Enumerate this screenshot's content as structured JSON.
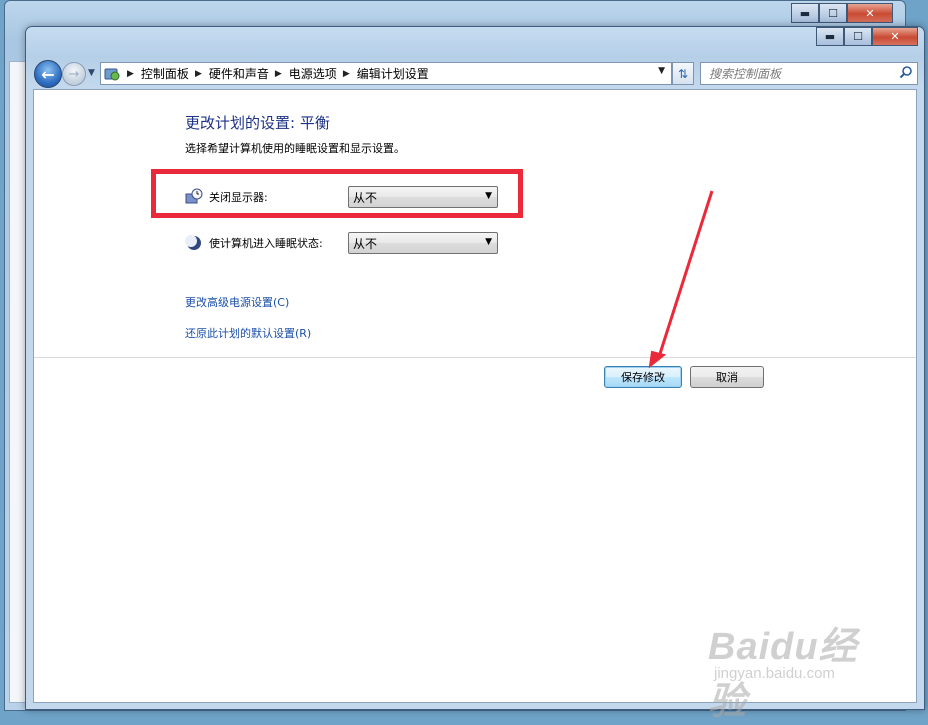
{
  "background_window": {
    "controls": {
      "minimize": "▬",
      "maximize": "☐",
      "close": "✕"
    }
  },
  "window": {
    "controls": {
      "minimize": "▬",
      "maximize": "☐",
      "close": "✕"
    }
  },
  "navigation": {
    "back_icon": "arrow-left-icon",
    "forward_icon": "arrow-right-icon",
    "breadcrumbs": [
      "控制面板",
      "硬件和声音",
      "电源选项",
      "编辑计划设置"
    ],
    "search_placeholder": "搜索控制面板"
  },
  "page": {
    "title": "更改计划的设置: 平衡",
    "description": "选择希望计算机使用的睡眠设置和显示设置。",
    "settings": [
      {
        "label": "关闭显示器:",
        "value": "从不",
        "icon": "monitor-clock-icon"
      },
      {
        "label": "使计算机进入睡眠状态:",
        "value": "从不",
        "icon": "moon-icon"
      }
    ],
    "links": [
      "更改高级电源设置(C)",
      "还原此计划的默认设置(R)"
    ],
    "buttons": {
      "save": "保存修改",
      "cancel": "取消"
    }
  },
  "watermark": {
    "brand": "Baidu经验",
    "url": "jingyan.baidu.com"
  },
  "colors": {
    "title": "#1e3287",
    "link": "#1b4fa8",
    "highlight": "#ea2a3a"
  }
}
